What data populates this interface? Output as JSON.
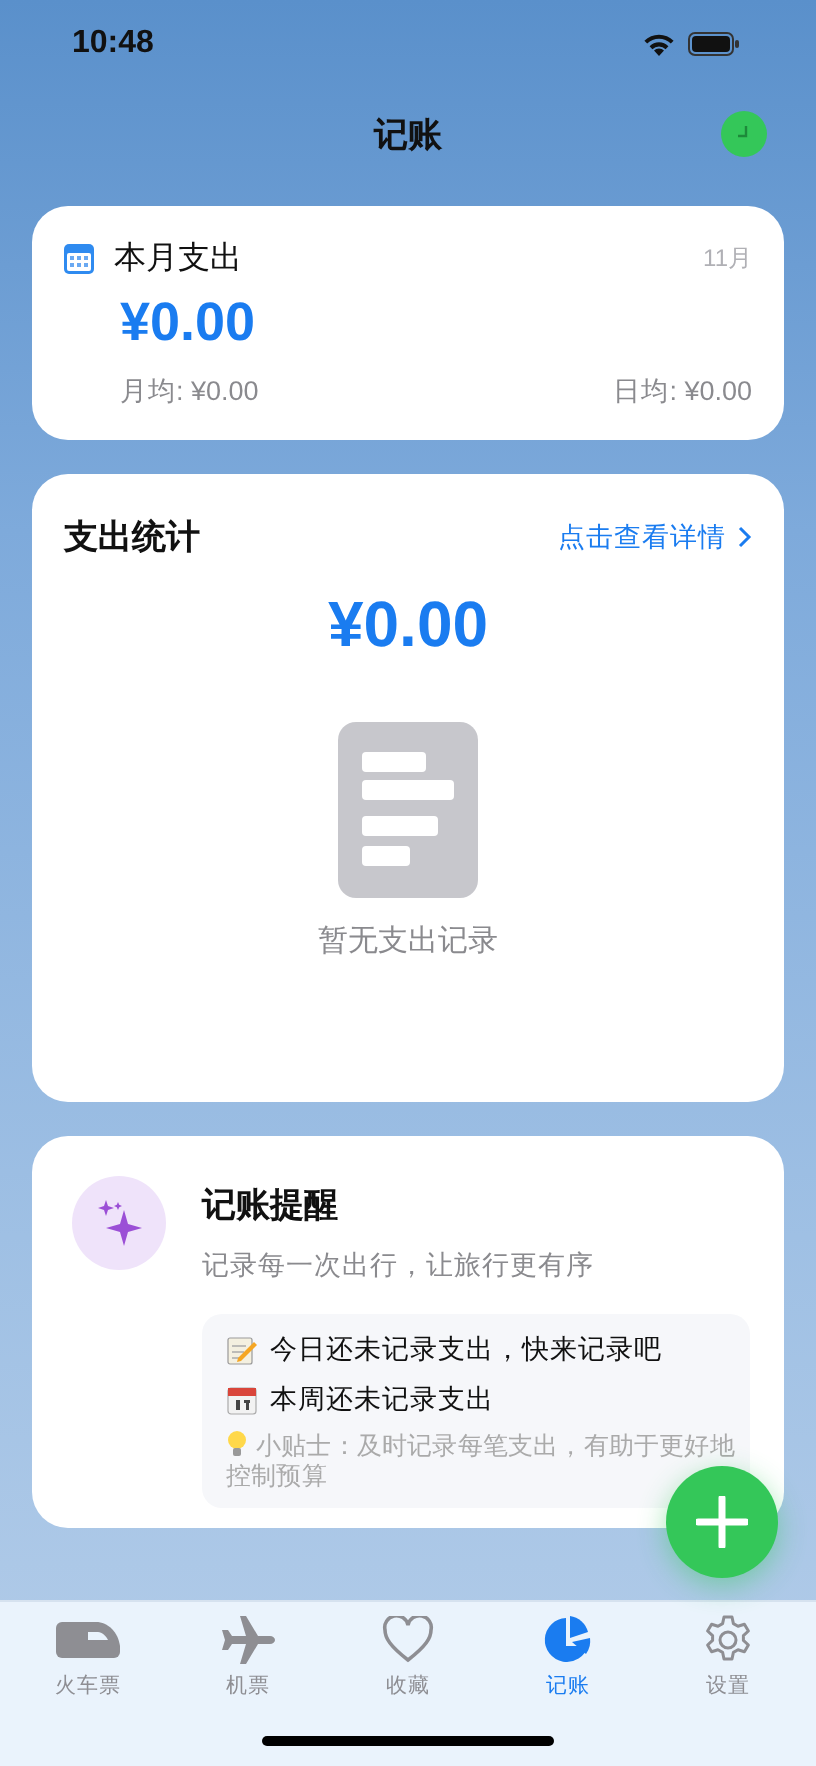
{
  "status_bar": {
    "time": "10:48"
  },
  "header": {
    "title": "记账"
  },
  "month_card": {
    "title": "本月支出",
    "month": "11月",
    "amount": "¥0.00",
    "monthly_avg": "月均: ¥0.00",
    "daily_avg": "日均: ¥0.00"
  },
  "stats_card": {
    "title": "支出统计",
    "link": "点击查看详情",
    "amount": "¥0.00",
    "empty": "暂无支出记录"
  },
  "reminder_card": {
    "title": "记账提醒",
    "subtitle": "记录每一次出行，让旅行更有序",
    "items": [
      {
        "kind": "memo",
        "text": "今日还未记录支出，快来记录吧"
      },
      {
        "kind": "calendar",
        "text": "本周还未记录支出"
      }
    ],
    "tip": "小贴士：及时记录每笔支出，有助于更好地控制预算"
  },
  "tabs": [
    {
      "kind": "train",
      "label": "火车票",
      "selected": false
    },
    {
      "kind": "plane",
      "label": "机票",
      "selected": false
    },
    {
      "kind": "heart",
      "label": "收藏",
      "selected": false
    },
    {
      "kind": "chart",
      "label": "记账",
      "selected": true
    },
    {
      "kind": "gear",
      "label": "设置",
      "selected": false
    }
  ]
}
